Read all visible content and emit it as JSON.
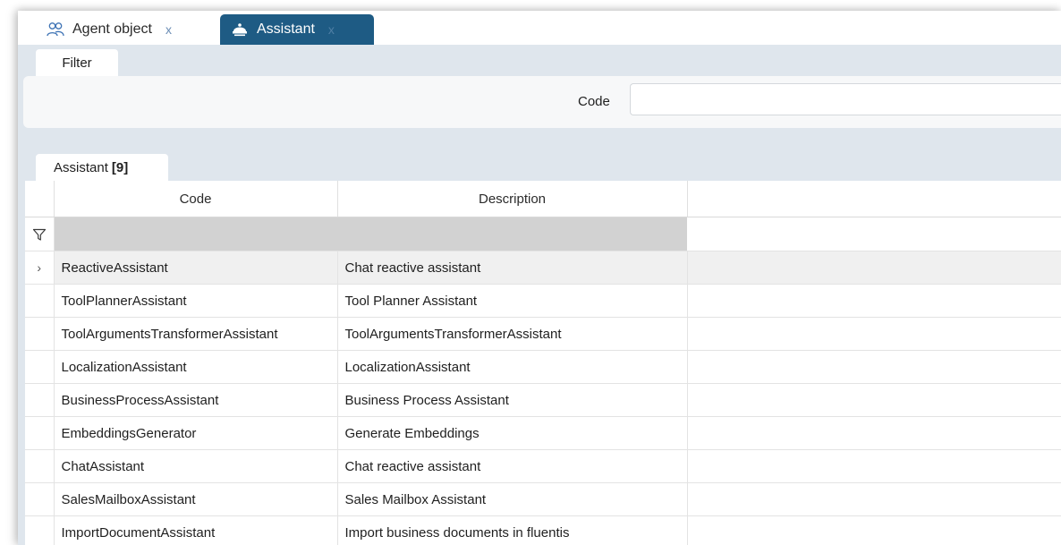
{
  "tabs": [
    {
      "label": "Agent object",
      "close": "x",
      "icon": "users-icon"
    },
    {
      "label": "Assistant",
      "close": "x",
      "icon": "assistant-icon"
    }
  ],
  "filter": {
    "tab_label": "Filter",
    "code_label": "Code",
    "code_value": ""
  },
  "grid": {
    "tab_label": "Assistant",
    "count": "[9]",
    "columns": [
      "Code",
      "Description"
    ],
    "rows": [
      {
        "code": "ReactiveAssistant",
        "description": "Chat reactive assistant"
      },
      {
        "code": "ToolPlannerAssistant",
        "description": "Tool Planner Assistant"
      },
      {
        "code": "ToolArgumentsTransformerAssistant",
        "description": "ToolArgumentsTransformerAssistant"
      },
      {
        "code": "LocalizationAssistant",
        "description": "LocalizationAssistant"
      },
      {
        "code": "BusinessProcessAssistant",
        "description": "Business Process Assistant"
      },
      {
        "code": "EmbeddingsGenerator",
        "description": "Generate Embeddings"
      },
      {
        "code": "ChatAssistant",
        "description": "Chat reactive assistant"
      },
      {
        "code": "SalesMailboxAssistant",
        "description": "Sales Mailbox Assistant"
      },
      {
        "code": "ImportDocumentAssistant",
        "description": "Import business documents in fluentis"
      }
    ],
    "current_row_indicator": "›"
  },
  "colors": {
    "active_tab": "#1e5b84",
    "panel_bg": "#dfe6ed",
    "filter_row": "#d2d2d2",
    "selected_row": "#f0f0f0"
  }
}
